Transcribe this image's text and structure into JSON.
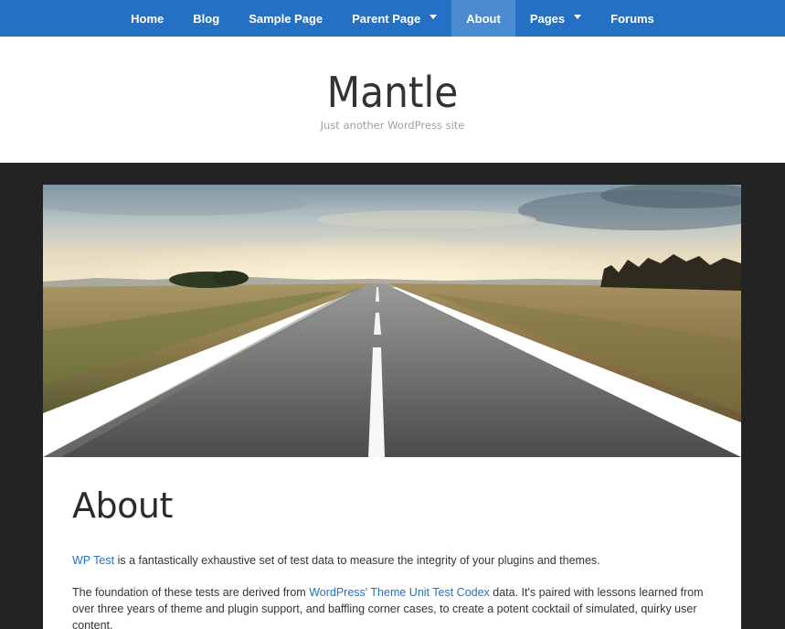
{
  "nav": {
    "items": [
      {
        "label": "Home",
        "has_dropdown": false
      },
      {
        "label": "Blog",
        "has_dropdown": false
      },
      {
        "label": "Sample Page",
        "has_dropdown": false
      },
      {
        "label": "Parent Page",
        "has_dropdown": true
      },
      {
        "label": "About",
        "has_dropdown": false,
        "active": true
      },
      {
        "label": "Pages",
        "has_dropdown": true
      },
      {
        "label": "Forums",
        "has_dropdown": false
      }
    ]
  },
  "site": {
    "title": "Mantle",
    "tagline": "Just another WordPress site"
  },
  "hero": {
    "image": "road-landscape"
  },
  "article": {
    "title": "About",
    "p1": {
      "link": "WP Test",
      "text": " is a fantastically exhaustive set of test data to measure the integrity of your plugins and themes."
    },
    "p2": {
      "before": "The foundation of these tests are derived from ",
      "link": "WordPress' Theme Unit Test Codex",
      "after": " data. It's paired with lessons learned from over three years of theme and plugin support, and baffling corner cases, to create a potent cocktail of simulated, quirky user content."
    }
  },
  "colors": {
    "nav_bg": "#2470c4",
    "nav_active_bg": "#4a8ad0",
    "page_bg": "#232323",
    "link": "#2470c4"
  }
}
